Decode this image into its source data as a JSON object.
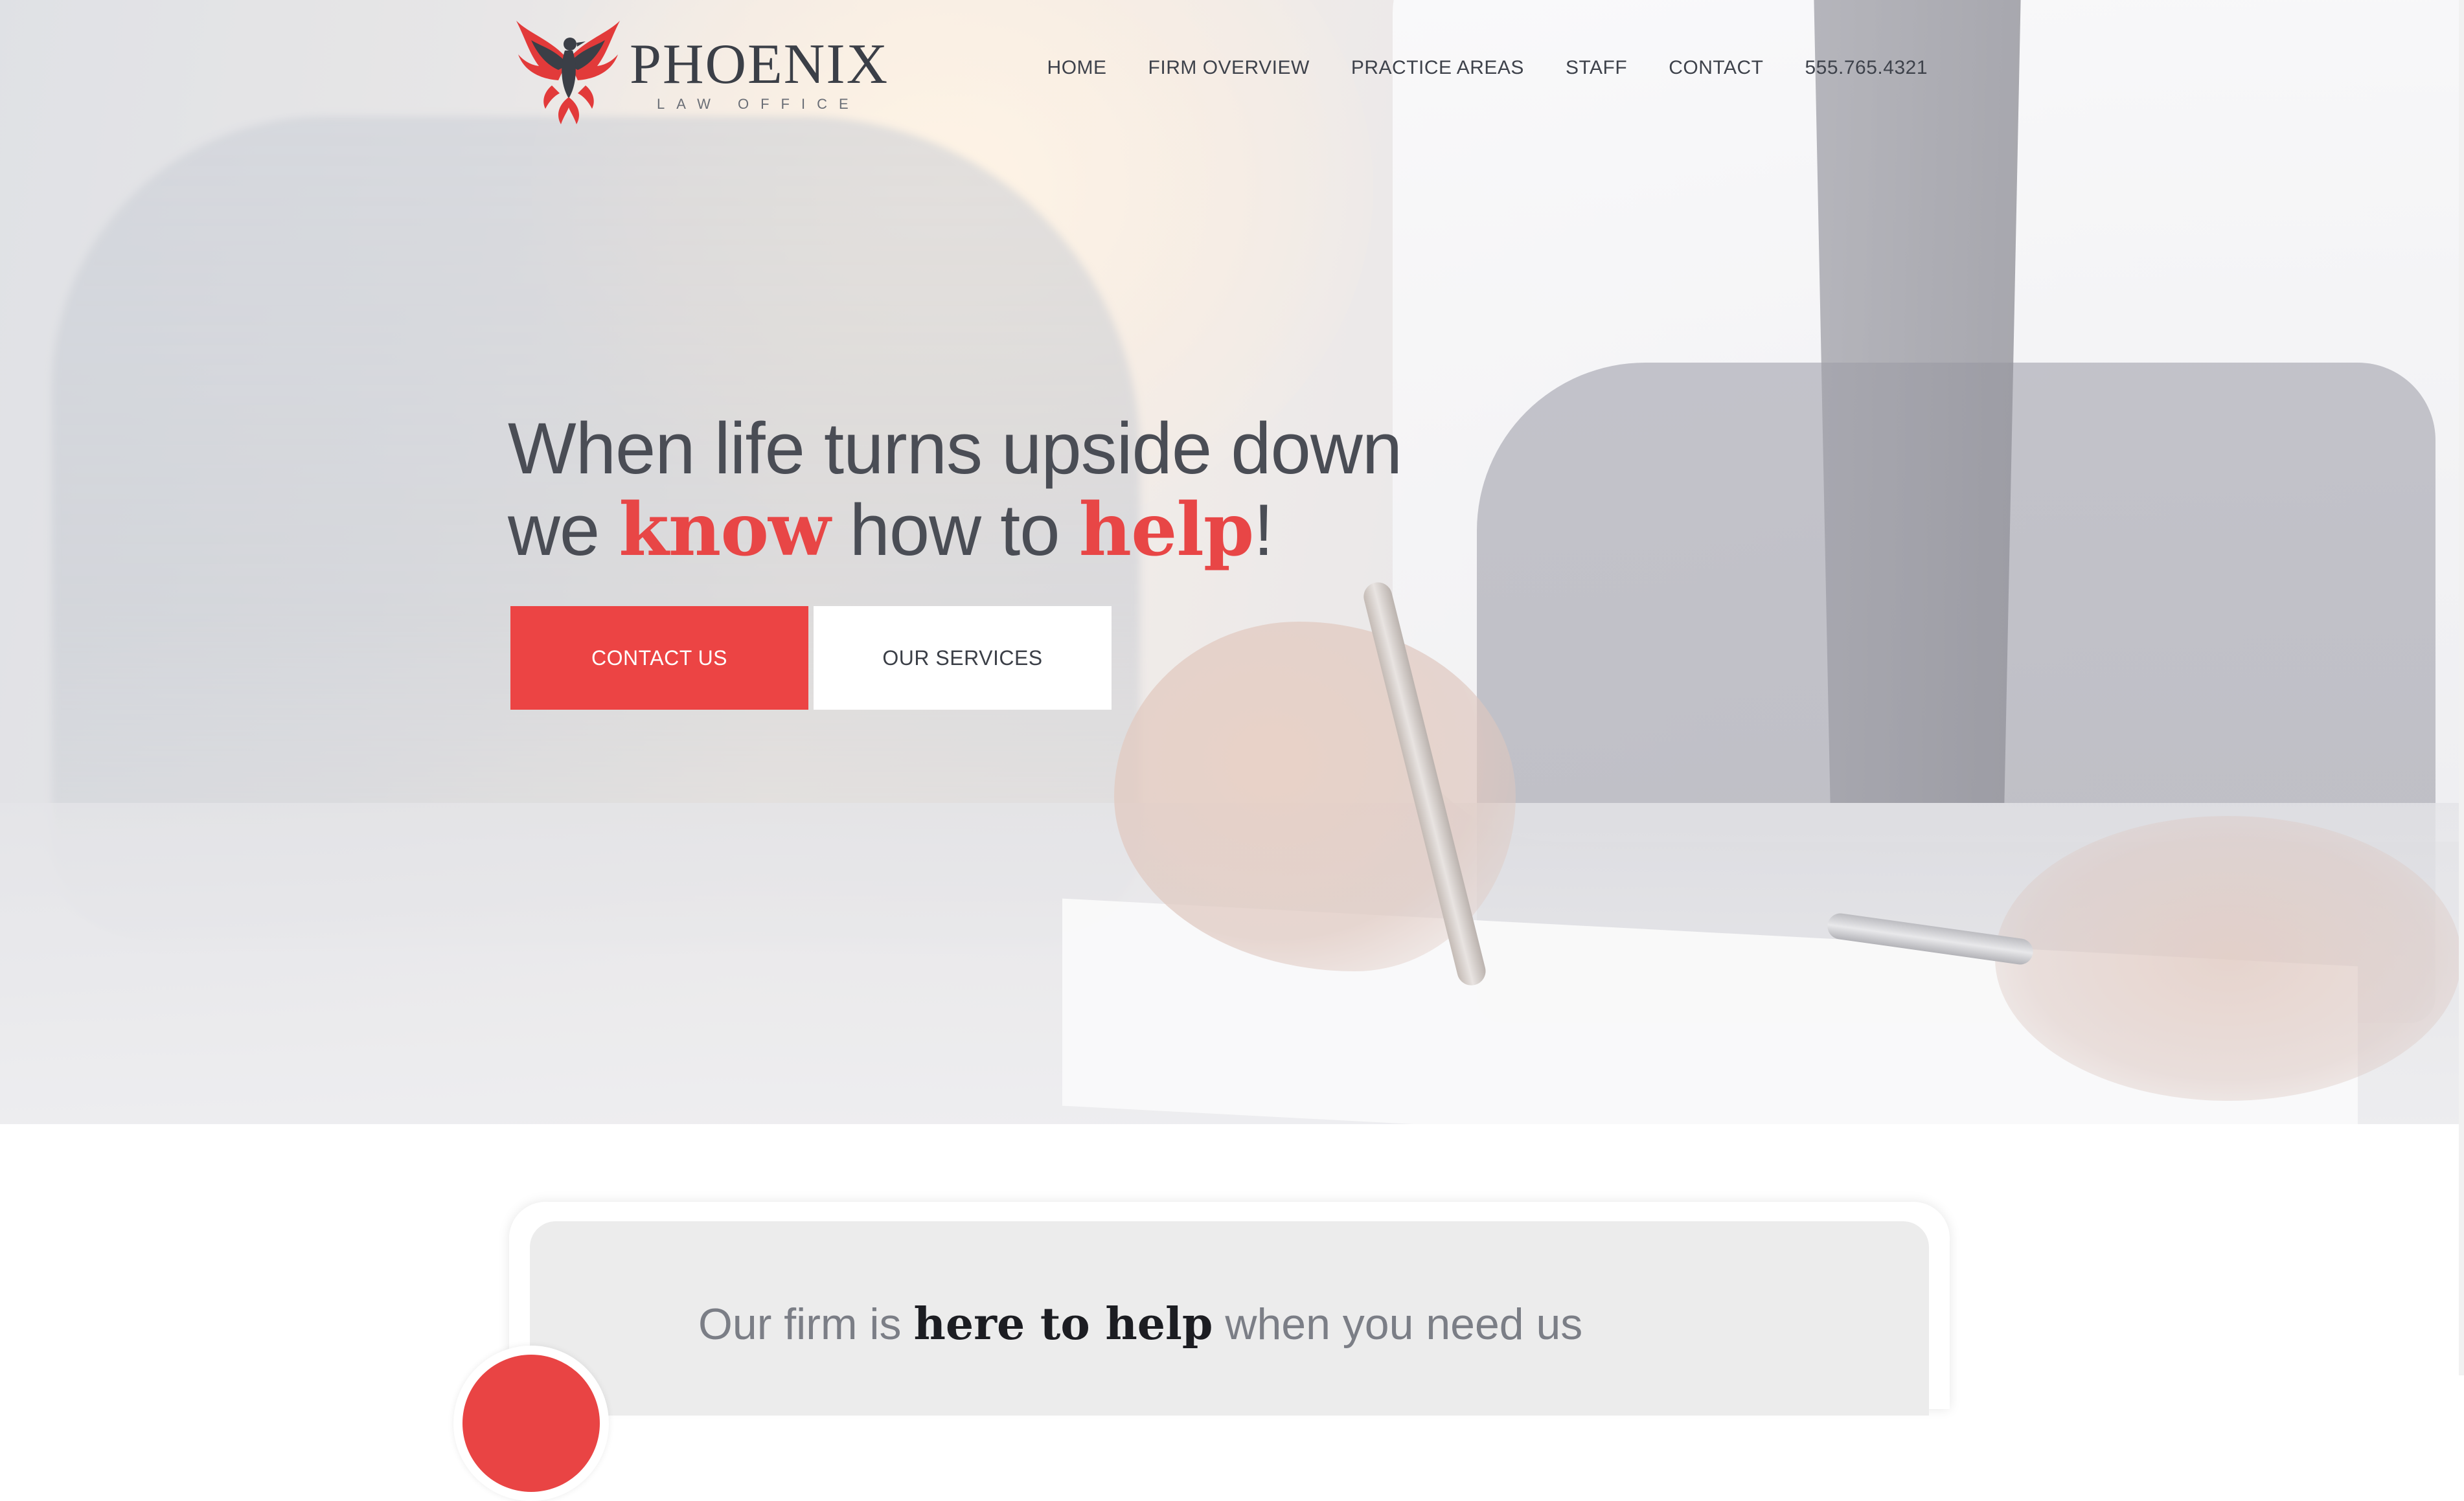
{
  "brand": {
    "name": "PHOENIX",
    "tagline": "LAW OFFICE",
    "icon": "phoenix-bird-icon",
    "accent_color": "#ec4444"
  },
  "nav": {
    "items": [
      {
        "label": "HOME"
      },
      {
        "label": "FIRM OVERVIEW"
      },
      {
        "label": "PRACTICE AREAS"
      },
      {
        "label": "STAFF"
      },
      {
        "label": "CONTACT"
      },
      {
        "label": "555.765.4321"
      }
    ]
  },
  "hero": {
    "line1": "When life turns upside down",
    "line2_prefix": "we ",
    "line2_em1": "know",
    "line2_mid": " how to ",
    "line2_em2": "help",
    "line2_suffix": "!",
    "buttons": {
      "contact": "CONTACT US",
      "services": "OUR SERVICES"
    }
  },
  "firm": {
    "heading_prefix": "Our firm is ",
    "heading_strong": "here to help",
    "heading_suffix": " when you need us"
  }
}
